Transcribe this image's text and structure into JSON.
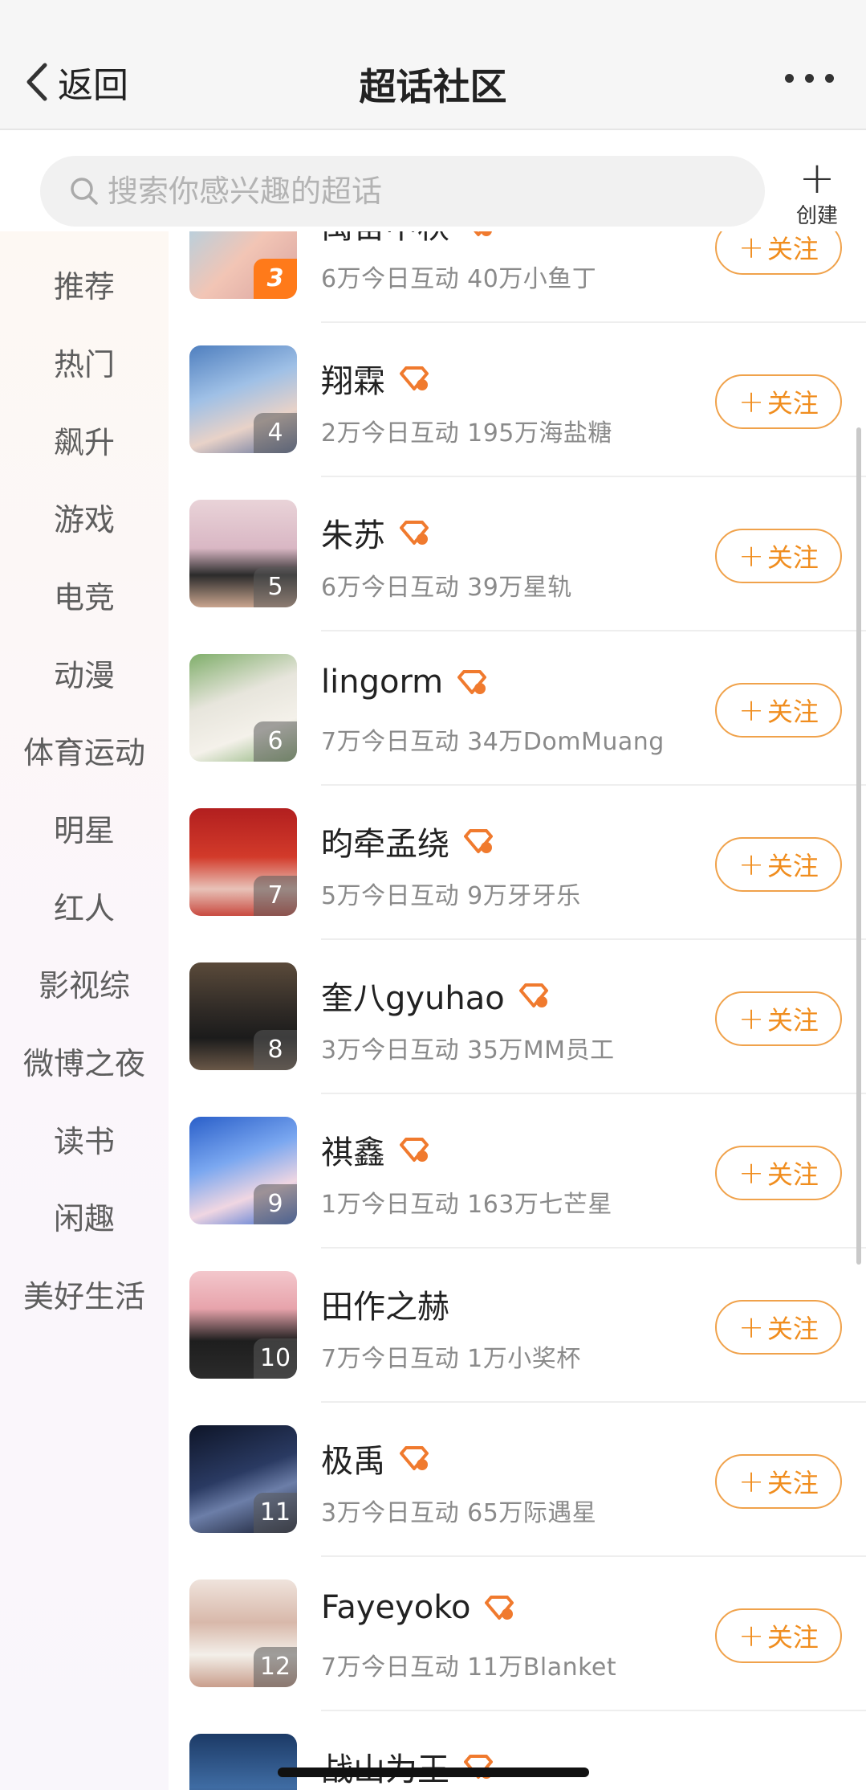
{
  "header": {
    "back_label": "返回",
    "title": "超话社区"
  },
  "search": {
    "placeholder": "搜索你感兴趣的超话",
    "create_label": "创建"
  },
  "sidebar": {
    "items": [
      "推荐",
      "热门",
      "飙升",
      "游戏",
      "电竞",
      "动漫",
      "体育运动",
      "明星",
      "红人",
      "影视综",
      "微博之夜",
      "读书",
      "闲趣",
      "美好生活"
    ]
  },
  "list": {
    "follow_label": "关注",
    "items": [
      {
        "name": "禹宙中秋",
        "stats": "6万今日互动 40万小鱼丁",
        "rank": "3"
      },
      {
        "name": "翔霖",
        "stats": "2万今日互动 195万海盐糖",
        "rank": "4"
      },
      {
        "name": "朱苏",
        "stats": "6万今日互动 39万星轨",
        "rank": "5"
      },
      {
        "name": "lingorm",
        "stats": "7万今日互动 34万DomMuang",
        "rank": "6"
      },
      {
        "name": "昀牵孟绕",
        "stats": "5万今日互动 9万牙牙乐",
        "rank": "7"
      },
      {
        "name": "奎八gyuhao",
        "stats": "3万今日互动 35万MM员工",
        "rank": "8"
      },
      {
        "name": "祺鑫",
        "stats": "1万今日互动 163万七芒星",
        "rank": "9"
      },
      {
        "name": "田作之赫",
        "stats": "7万今日互动 1万小奖杯",
        "rank": "10"
      },
      {
        "name": "极禹",
        "stats": "3万今日互动 65万际遇星",
        "rank": "11"
      },
      {
        "name": "Fayeyoko",
        "stats": "7万今日互动 11万Blanket",
        "rank": "12"
      },
      {
        "name": "战山为王",
        "stats": "",
        "rank": ""
      }
    ]
  },
  "colors": {
    "accent": "#f08d1e",
    "badge": "#f07a2e"
  }
}
